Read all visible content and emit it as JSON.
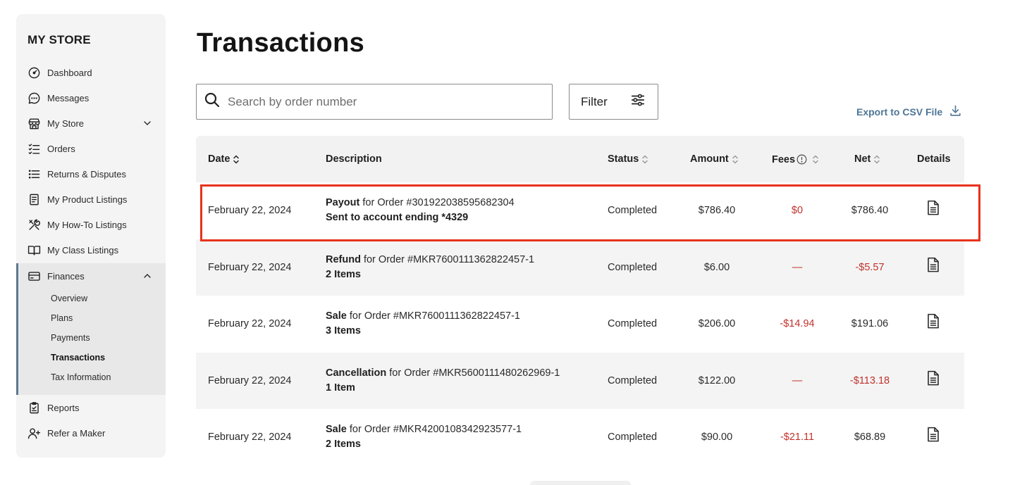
{
  "sidebar": {
    "title": "MY STORE",
    "items": [
      {
        "label": "Dashboard",
        "icon": "gauge-icon"
      },
      {
        "label": "Messages",
        "icon": "chat-icon"
      },
      {
        "label": "My Store",
        "icon": "storefront-icon"
      },
      {
        "label": "Orders",
        "icon": "checklist-icon"
      },
      {
        "label": "Returns & Disputes",
        "icon": "list-icon"
      },
      {
        "label": "My Product Listings",
        "icon": "document-list-icon"
      },
      {
        "label": "My How-To Listings",
        "icon": "tools-icon"
      },
      {
        "label": "My Class Listings",
        "icon": "book-icon"
      },
      {
        "label": "Finances",
        "icon": "credit-card-icon"
      },
      {
        "label": "Reports",
        "icon": "clipboard-icon"
      },
      {
        "label": "Refer a Maker",
        "icon": "add-user-icon"
      }
    ],
    "finance_sub": [
      "Overview",
      "Plans",
      "Payments",
      "Transactions",
      "Tax Information"
    ],
    "active_sub": "Transactions"
  },
  "main": {
    "title": "Transactions",
    "search_placeholder": "Search by order number",
    "filter_label": "Filter",
    "export_label": "Export to CSV File"
  },
  "table": {
    "headers": {
      "date": "Date",
      "description": "Description",
      "status": "Status",
      "amount": "Amount",
      "fees": "Fees",
      "net": "Net",
      "details": "Details"
    },
    "rows": [
      {
        "date": "February 22, 2024",
        "kind": "Payout",
        "for_text": " for Order #301922038595682304",
        "line2": "Sent to account ending *4329",
        "status": "Completed",
        "amount": "$786.40",
        "fees": "$0",
        "net": "$786.40"
      },
      {
        "date": "February 22, 2024",
        "kind": "Refund",
        "for_text": " for Order #MKR7600111362822457-1",
        "line2": "2 Items",
        "status": "Completed",
        "amount": "$6.00",
        "fees": "—",
        "net": "-$5.57"
      },
      {
        "date": "February 22, 2024",
        "kind": "Sale",
        "for_text": " for Order #MKR7600111362822457-1",
        "line2": "3 Items",
        "status": "Completed",
        "amount": "$206.00",
        "fees": "-$14.94",
        "net": "$191.06"
      },
      {
        "date": "February 22, 2024",
        "kind": "Cancellation",
        "for_text": " for Order #MKR5600111480262969-1",
        "line2": "1 Item",
        "status": "Completed",
        "amount": "$122.00",
        "fees": "—",
        "net": "-$113.18"
      },
      {
        "date": "February 22, 2024",
        "kind": "Sale",
        "for_text": " for Order #MKR4200108342923577-1",
        "line2": "2 Items",
        "status": "Completed",
        "amount": "$90.00",
        "fees": "-$21.11",
        "net": "$68.89"
      }
    ]
  },
  "colors": {
    "accent": "#4e7597",
    "negative": "#c0322c",
    "highlight": "#e8321c"
  }
}
